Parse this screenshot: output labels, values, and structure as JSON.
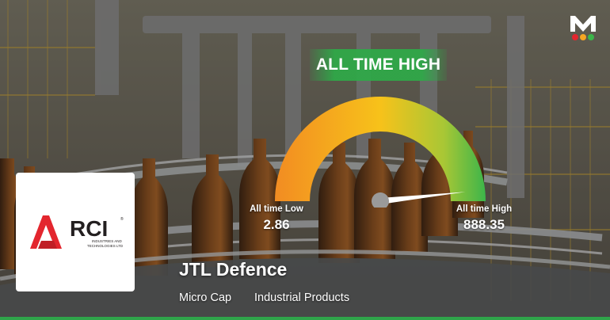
{
  "banner": {
    "title": "ALL TIME HIGH"
  },
  "gauge": {
    "low_label": "All time Low",
    "low_value": "2.86",
    "high_label": "All time High",
    "high_value": "888.35",
    "needle_position": 0.98,
    "colors": {
      "start": "#f5a623",
      "mid": "#f7c21a",
      "end": "#3cb54a",
      "left": "#f28c22"
    }
  },
  "company": {
    "name": "JTL Defence",
    "market_cap": "Micro Cap",
    "sector": "Industrial Products",
    "logo_text": "RCI",
    "logo_subtext_1": "INDUSTRIES AND",
    "logo_subtext_2": "TECHNOLOGIES LTD",
    "logo_color": "#e3262e"
  },
  "brand": {
    "icon": "m-logo-icon",
    "accent": "#2fa44a"
  }
}
